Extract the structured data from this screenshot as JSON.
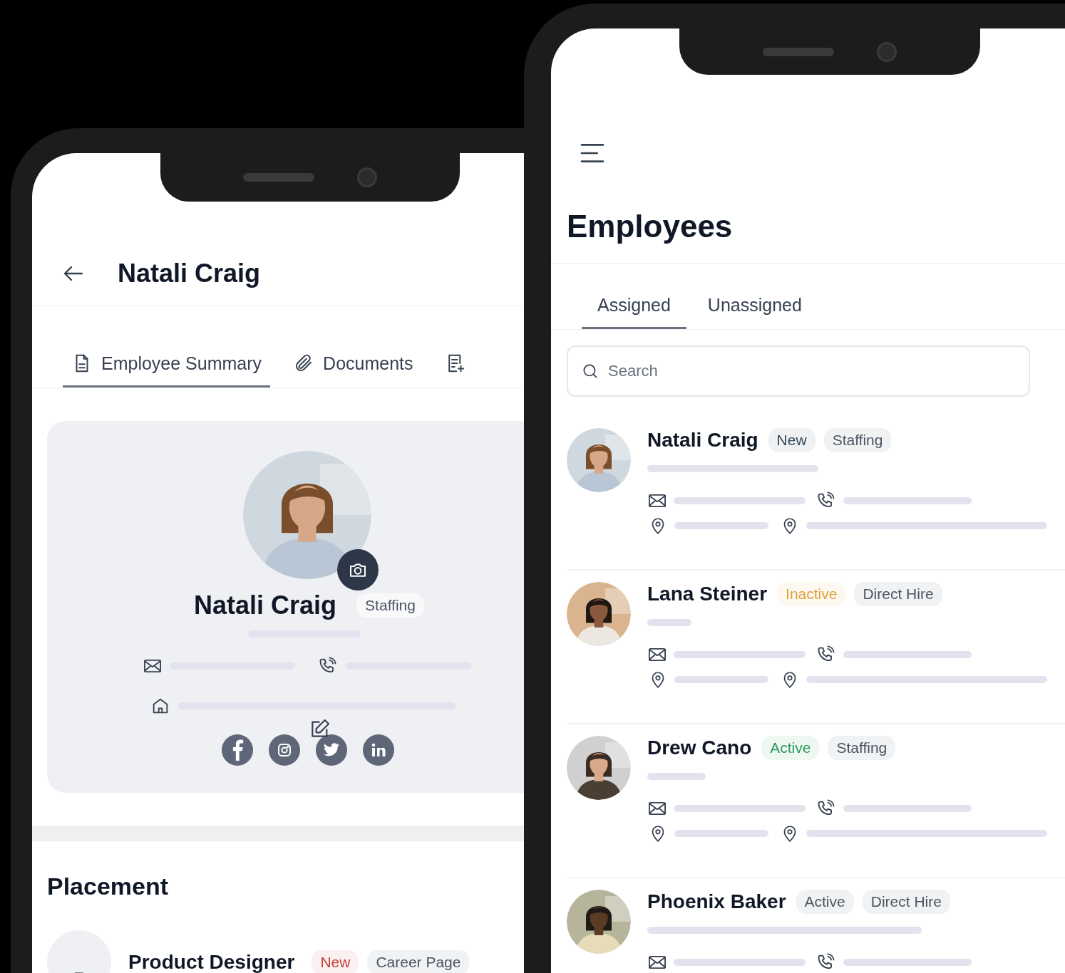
{
  "left_screen": {
    "title": "Natali Craig",
    "tabs": [
      {
        "label": "Employee Summary",
        "kind": "document",
        "selected": true
      },
      {
        "label": "Documents",
        "kind": "paperclip",
        "selected": false
      },
      {
        "kind": "form",
        "selected": false
      }
    ],
    "profile": {
      "name": "Natali Craig",
      "tag": "Staffing"
    },
    "placement": {
      "heading": "Placement",
      "items": [
        {
          "title": "Product Designer",
          "tags": [
            {
              "label": "New",
              "color": "#c0413a"
            },
            {
              "label": "Career Page",
              "color": "#4b5563"
            }
          ]
        }
      ]
    }
  },
  "right_screen": {
    "title": "Employees",
    "tabs": [
      {
        "label": "Assigned",
        "selected": true
      },
      {
        "label": "Unassigned",
        "selected": false
      }
    ],
    "search": {
      "placeholder": "Search"
    },
    "employees": [
      {
        "name": "Natali Craig",
        "tags": [
          {
            "label": "New",
            "color": "#344a5a"
          },
          {
            "label": "Staffing",
            "color": "#4b5563"
          }
        ]
      },
      {
        "name": "Lana Steiner",
        "tags": [
          {
            "label": "Inactive",
            "color": "#e0a03a"
          },
          {
            "label": "Direct Hire",
            "color": "#4b5563"
          }
        ]
      },
      {
        "name": "Drew Cano",
        "tags": [
          {
            "label": "Active",
            "color": "#2f9a5a"
          },
          {
            "label": "Staffing",
            "color": "#4b5563"
          }
        ]
      },
      {
        "name": "Phoenix Baker",
        "tags": [
          {
            "label": "Active",
            "color": "#4b5563"
          },
          {
            "label": "Direct Hire",
            "color": "#4b5563"
          }
        ]
      }
    ]
  }
}
